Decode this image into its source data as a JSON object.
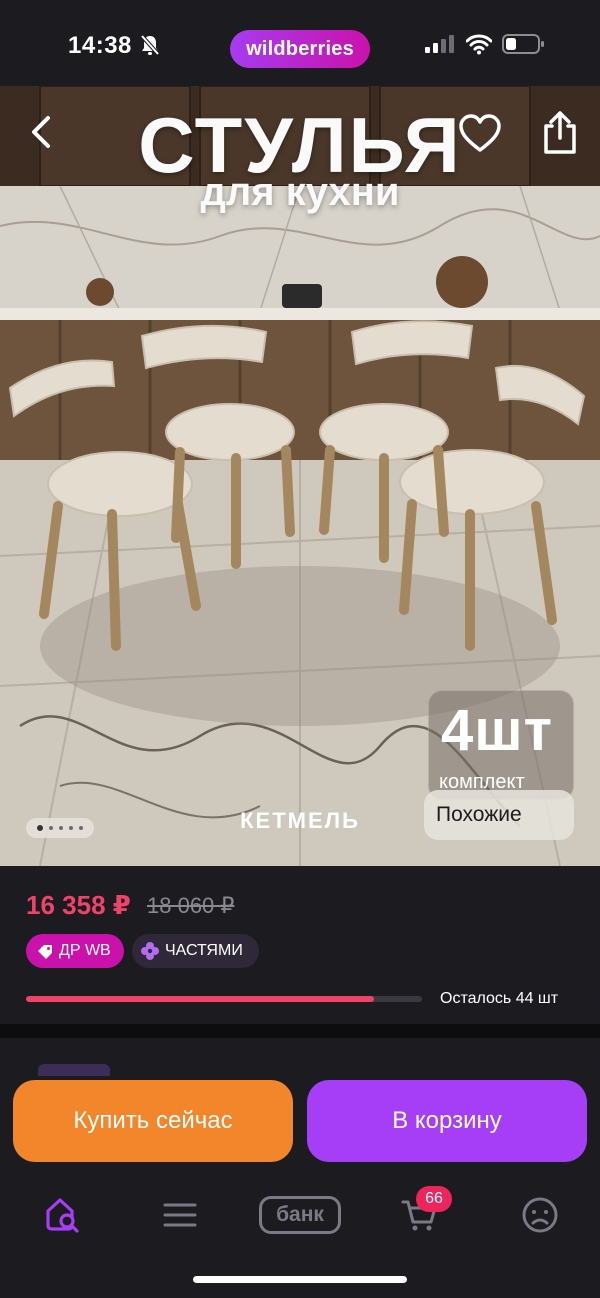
{
  "status_bar": {
    "time": "14:38",
    "app_logo": "wildberries",
    "icons": [
      "bell-off-icon",
      "signal-icon",
      "wifi-icon",
      "battery-icon"
    ]
  },
  "hero": {
    "title": "СТУЛЬЯ",
    "subtitle": "для кухни",
    "quantity": "4шт",
    "quantity_label": "комплект",
    "brand": "КЕТМЕЛЬ",
    "similar_button": "Похожие",
    "image_count": 5,
    "active_image": 1,
    "icons": [
      "back-icon",
      "heart-icon",
      "share-icon"
    ]
  },
  "price": {
    "current": "16 358 ₽",
    "old": "18 060 ₽",
    "current_color": "#f0436b"
  },
  "badges": {
    "dr_wb": "ДР WB",
    "dr_wb_color": "#cb11ab",
    "installments": "ЧАСТЯМИ",
    "icons": [
      "tag-icon",
      "parts-icon"
    ]
  },
  "stock": {
    "text": "Осталось 44 шт",
    "fill_percent": 88
  },
  "actions": {
    "buy_now": "Купить сейчас",
    "buy_now_color": "#f3862a",
    "add_to_cart": "В корзину",
    "add_to_cart_color": "#a73ef7"
  },
  "bottom_nav": {
    "bank_label": "банк",
    "cart_count": "66",
    "items": [
      "home-search-icon",
      "catalog-icon",
      "bank-icon",
      "cart-icon",
      "profile-icon"
    ],
    "active": "home-search-icon"
  }
}
